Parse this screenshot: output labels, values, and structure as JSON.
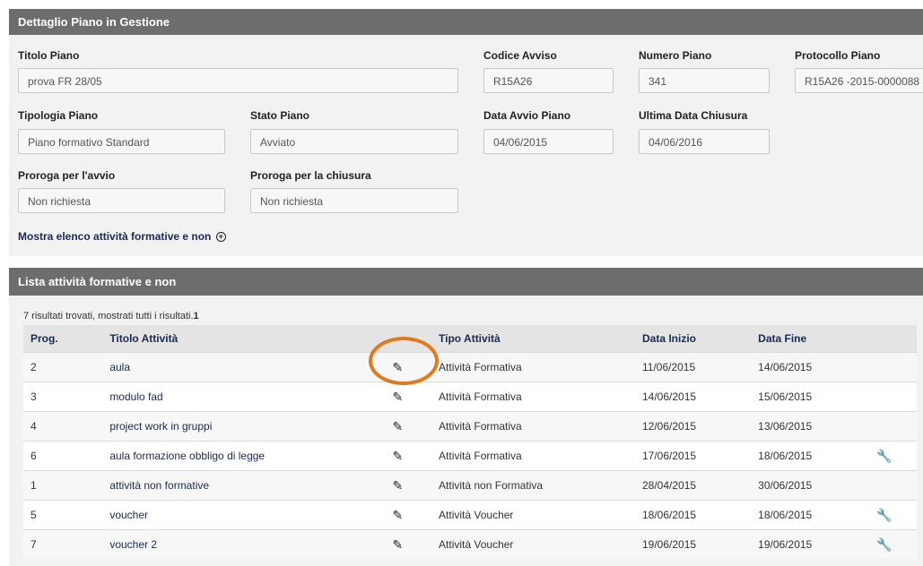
{
  "detail_panel": {
    "title": "Dettaglio Piano in Gestione"
  },
  "fields": {
    "titolo_piano": {
      "label": "Titolo Piano",
      "value": "prova FR 28/05"
    },
    "codice_avviso": {
      "label": "Codice Avviso",
      "value": "R15A26"
    },
    "numero_piano": {
      "label": "Numero Piano",
      "value": "341"
    },
    "protocollo_piano": {
      "label": "Protocollo Piano",
      "value": "R15A26 -2015-0000088"
    },
    "tipologia_piano": {
      "label": "Tipologia Piano",
      "value": "Piano formativo Standard"
    },
    "stato_piano": {
      "label": "Stato Piano",
      "value": "Avviato"
    },
    "data_avvio": {
      "label": "Data Avvio Piano",
      "value": "04/06/2015"
    },
    "ultima_chiusura": {
      "label": "Ultima Data Chiusura",
      "value": "04/06/2016"
    },
    "proroga_avvio": {
      "label": "Proroga per l'avvio",
      "value": "Non richiesta"
    },
    "proroga_chiusura": {
      "label": "Proroga per la chiusura",
      "value": "Non richiesta"
    }
  },
  "toggle_link": {
    "label": "Mostra elenco attività formative e non",
    "icon": "circle-plus-icon",
    "icon_glyph": "+"
  },
  "list_panel": {
    "title": "Lista attività formative e non",
    "results_text": "7 risultati trovati, mostrati tutti i risultati.",
    "page": "1"
  },
  "table": {
    "columns": [
      "Prog.",
      "Titolo Attività",
      "",
      "Tipo Attività",
      "Data Inizio",
      "Data Fine",
      ""
    ],
    "rows": [
      {
        "prog": "2",
        "titolo": "aula",
        "tipo": "Attività Formativa",
        "inizio": "11/06/2015",
        "fine": "14/06/2015",
        "wrench": false
      },
      {
        "prog": "3",
        "titolo": "modulo fad",
        "tipo": "Attività Formativa",
        "inizio": "14/06/2015",
        "fine": "15/06/2015",
        "wrench": false
      },
      {
        "prog": "4",
        "titolo": "project work in gruppi",
        "tipo": "Attività Formativa",
        "inizio": "12/06/2015",
        "fine": "13/06/2015",
        "wrench": false
      },
      {
        "prog": "6",
        "titolo": "aula formazione obbligo di legge",
        "tipo": "Attività Formativa",
        "inizio": "17/06/2015",
        "fine": "18/06/2015",
        "wrench": true
      },
      {
        "prog": "1",
        "titolo": "attività non formative",
        "tipo": "Attività non Formativa",
        "inizio": "28/04/2015",
        "fine": "30/06/2015",
        "wrench": false
      },
      {
        "prog": "5",
        "titolo": "voucher",
        "tipo": "Attività Voucher",
        "inizio": "18/06/2015",
        "fine": "18/06/2015",
        "wrench": true
      },
      {
        "prog": "7",
        "titolo": "voucher 2",
        "tipo": "Attività Voucher",
        "inizio": "19/06/2015",
        "fine": "19/06/2015",
        "wrench": true
      }
    ]
  },
  "icons": {
    "edit": "pencil-icon",
    "edit_glyph": "✎",
    "tool": "wrench-icon",
    "tool_glyph": "🔧"
  },
  "colors": {
    "panel_header": "#6d6d6d",
    "panel_body": "#f2f2f2",
    "link": "#1a2a52",
    "annotation": "#e07a1f"
  }
}
